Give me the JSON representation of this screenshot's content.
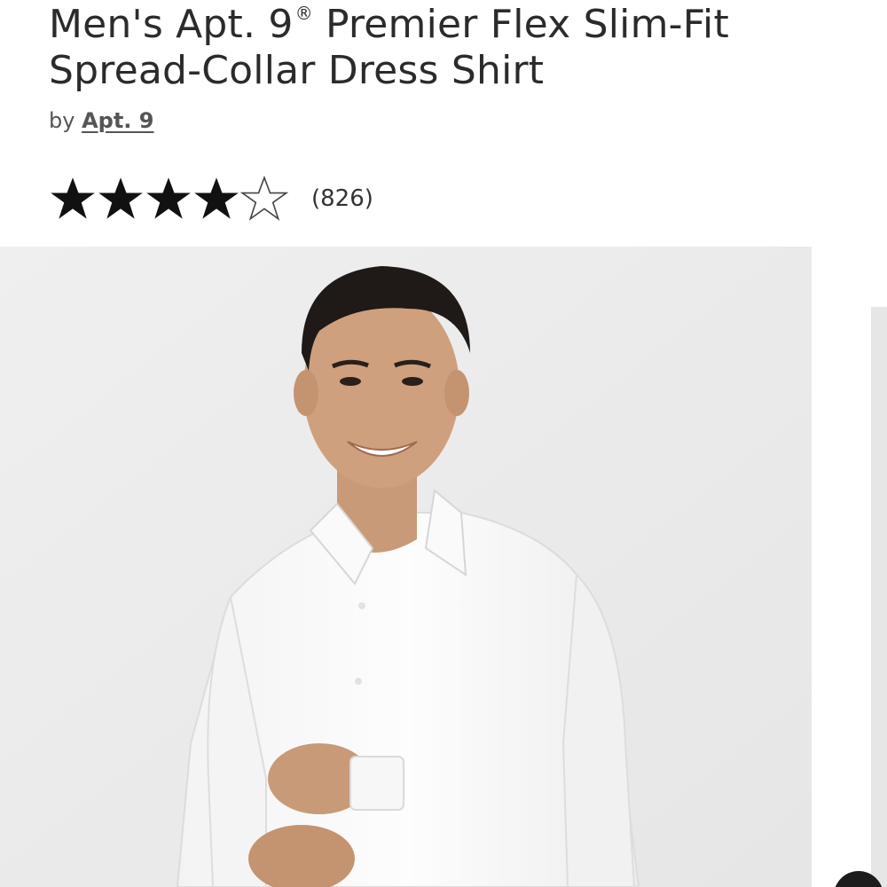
{
  "product": {
    "title_main": "Men's Apt. 9",
    "title_registered": "®",
    "title_rest": " Premier Flex Slim-Fit Spread-Collar Dress Shirt",
    "by_prefix": "by",
    "brand": "Apt. 9"
  },
  "rating": {
    "value": 4,
    "max": 5,
    "count_label": "(826)"
  },
  "colors": {
    "star_fill": "#111111",
    "star_empty_stroke": "#444444",
    "photo_background": "#ececec"
  },
  "icons": {
    "star_filled": "star-filled-icon",
    "star_empty": "star-outline-icon"
  }
}
